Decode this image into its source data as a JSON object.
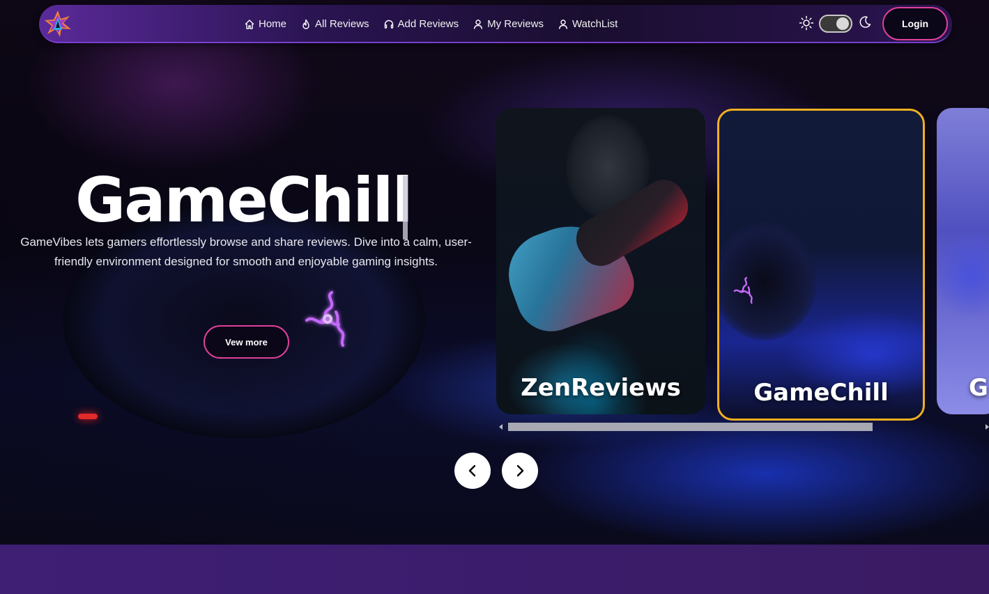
{
  "nav": {
    "links": [
      {
        "label": "Home",
        "icon": "home-icon"
      },
      {
        "label": "All Reviews",
        "icon": "flame-icon"
      },
      {
        "label": "Add Reviews",
        "icon": "headset-icon"
      },
      {
        "label": "My Reviews",
        "icon": "user-icon"
      },
      {
        "label": "WatchList",
        "icon": "user-icon"
      }
    ],
    "login_label": "Login",
    "theme_toggle": {
      "light_icon": "sun-icon",
      "dark_icon": "moon-icon",
      "state": "dark"
    }
  },
  "hero": {
    "title": "GameChill",
    "description": "GameVibes lets gamers effortlessly browse and share reviews. Dive into a calm, user-friendly environment designed for smooth and enjoyable gaming insights.",
    "cta_label": "Vew more"
  },
  "carousel": {
    "cards": [
      {
        "title": "ZenReviews",
        "active": false
      },
      {
        "title": "GameChill",
        "active": true
      },
      {
        "title": "G",
        "active": false
      }
    ],
    "prev_icon": "chevron-left-icon",
    "next_icon": "chevron-right-icon"
  },
  "colors": {
    "accent_border": "#e0409a",
    "active_card_border": "#f0b020",
    "bottom_band": "#3d1d6e"
  }
}
